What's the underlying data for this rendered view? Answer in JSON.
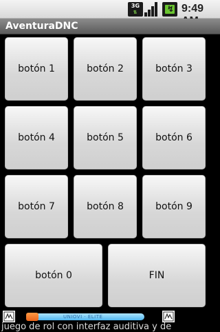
{
  "status_bar": {
    "network_label": "3G",
    "time": "9:49",
    "ampm": "AM"
  },
  "app": {
    "title": "AventuraDNC"
  },
  "buttons": [
    {
      "label": "botón 1"
    },
    {
      "label": "botón 2"
    },
    {
      "label": "botón 3"
    },
    {
      "label": "botón 4"
    },
    {
      "label": "botón 5"
    },
    {
      "label": "botón 6"
    },
    {
      "label": "botón 7"
    },
    {
      "label": "botón 8"
    },
    {
      "label": "botón 9"
    },
    {
      "label": "botón 0"
    },
    {
      "label": "FIN"
    }
  ],
  "ad": {
    "slider_text": "UNIOVI · ELITE",
    "ticker": "juego de rol con interfaz auditiva y de"
  }
}
